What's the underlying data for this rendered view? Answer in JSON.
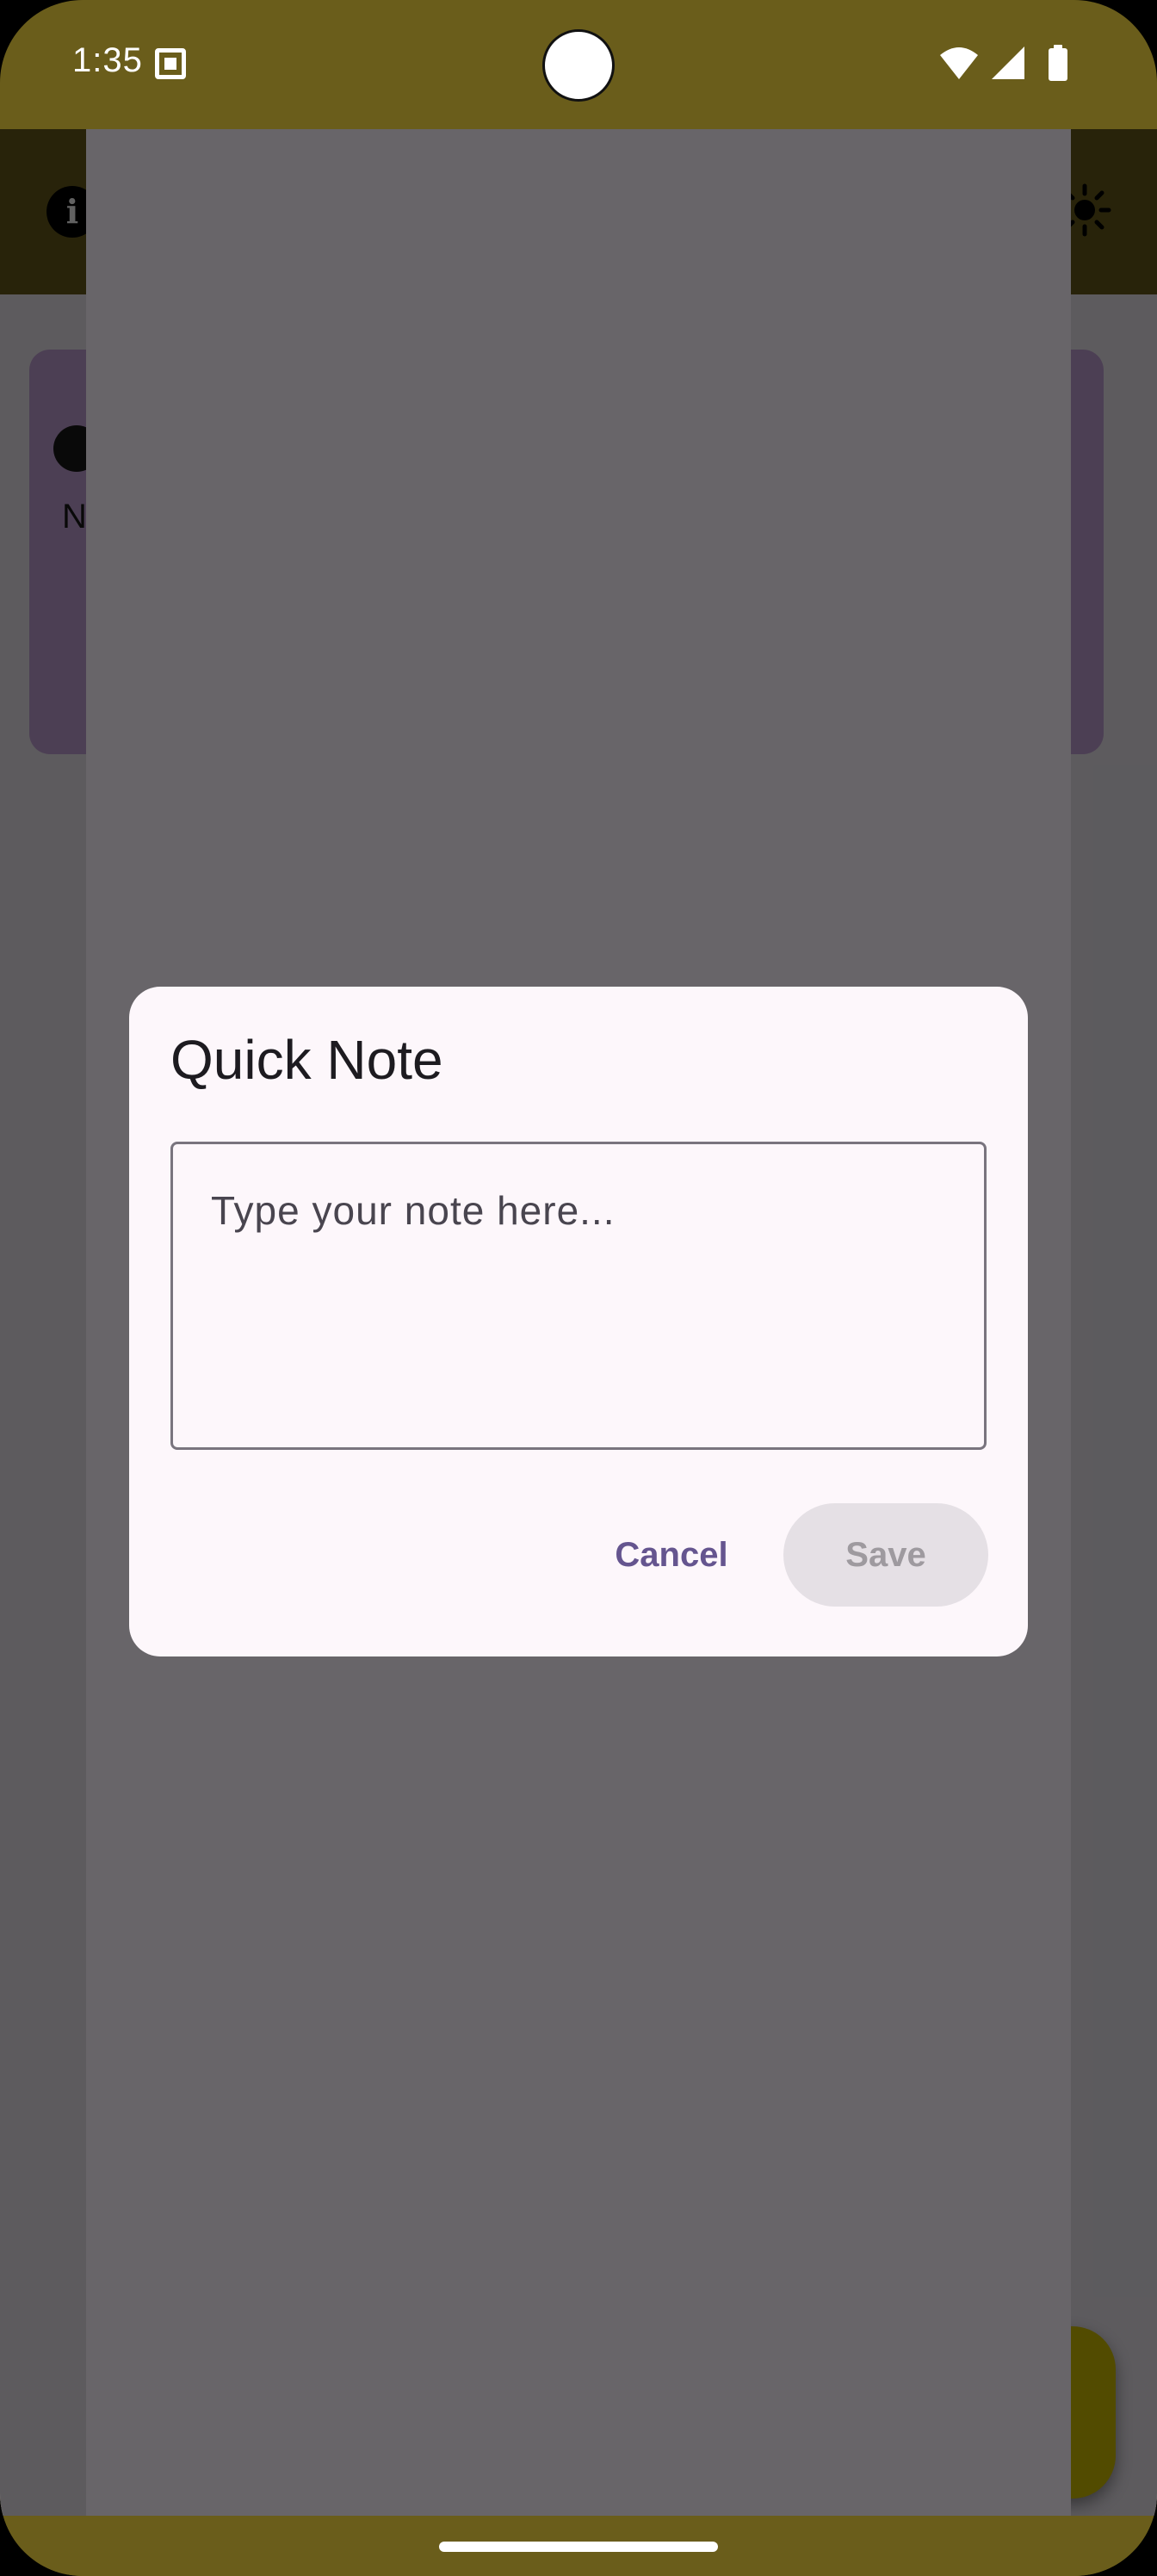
{
  "status_bar": {
    "time": "1:35",
    "icons": [
      "sim-card-icon",
      "wifi-icon",
      "cellular-signal-icon",
      "battery-icon"
    ]
  },
  "app_bar": {
    "left_icon": "info-icon",
    "right_icon": "sun-icon",
    "color": "#6a5d1b"
  },
  "background_card": {
    "visible_letter": "N",
    "icon": "palette-icon",
    "color": "#c9a7dc"
  },
  "dialog": {
    "title": "Quick Note",
    "input": {
      "value": "",
      "placeholder": "Type your note here..."
    },
    "cancel_label": "Cancel",
    "save_label": "Save",
    "save_enabled": false,
    "accent_color": "#65558f"
  },
  "fab": {
    "icon": "add-icon",
    "color": "#d8c400"
  }
}
